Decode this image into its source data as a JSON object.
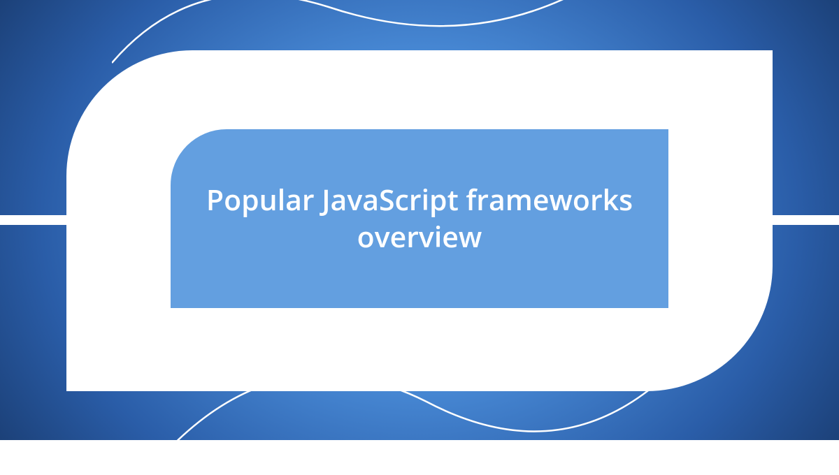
{
  "title": "Popular JavaScript frameworks overview",
  "colors": {
    "background_dark": "#081428",
    "background_mid": "#2a5da8",
    "background_light": "#6ca8e8",
    "panel": "#639fe0",
    "frame": "#ffffff",
    "text": "#ffffff"
  }
}
